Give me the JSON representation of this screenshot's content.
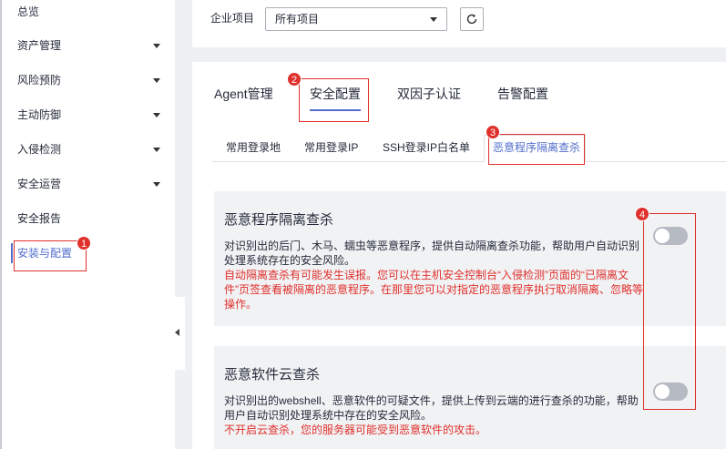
{
  "sidebar": {
    "items": [
      {
        "label": "总览"
      },
      {
        "label": "资产管理"
      },
      {
        "label": "风险预防"
      },
      {
        "label": "主动防御"
      },
      {
        "label": "入侵检测"
      },
      {
        "label": "安全运营"
      },
      {
        "label": "安全报告"
      },
      {
        "label": "安装与配置"
      }
    ]
  },
  "header": {
    "project_label": "企业项目",
    "project_value": "所有项目"
  },
  "tabs": [
    "Agent管理",
    "安全配置",
    "双因子认证",
    "告警配置"
  ],
  "subtabs": [
    "常用登录地",
    "常用登录IP",
    "SSH登录IP白名单",
    "恶意程序隔离查杀"
  ],
  "badges": [
    "1",
    "2",
    "3",
    "4"
  ],
  "sections": [
    {
      "title": "恶意程序隔离查杀",
      "desc": "对识别出的后门、木马、蠕虫等恶意程序，提供自动隔离查杀功能，帮助用户自动识别处理系统存在的安全风险。",
      "warn": "自动隔离查杀有可能发生误报。您可以在主机安全控制台“入侵检测”页面的“已隔离文件”页签查看被隔离的恶意程序。在那里您可以对指定的恶意程序执行取消隔离、忽略等操作。"
    },
    {
      "title": "恶意软件云查杀",
      "desc": "对识别出的webshell、恶意软件的可疑文件，提供上传到云端的进行查杀的功能，帮助用户自动识别处理系统中存在的安全风险。",
      "warn": "不开启云查杀，您的服务器可能受到恶意软件的攻击。"
    }
  ],
  "colors": {
    "accent": "#526ecc",
    "annotation": "#e0302c",
    "toggle_off": "#b6bac2"
  }
}
